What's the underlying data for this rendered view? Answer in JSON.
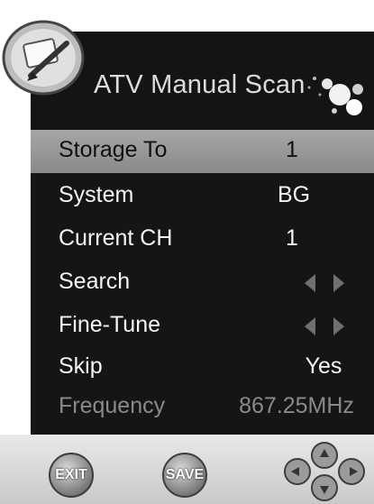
{
  "header": {
    "title": "ATV Manual Scan"
  },
  "rows": [
    {
      "label": "Storage To",
      "value": "1"
    },
    {
      "label": "System",
      "value": "BG"
    },
    {
      "label": "Current CH",
      "value": "1"
    },
    {
      "label": "Search",
      "value": ""
    },
    {
      "label": "Fine-Tune",
      "value": ""
    },
    {
      "label": "Skip",
      "value": "Yes"
    },
    {
      "label": "Frequency",
      "value": "867.25MHz"
    }
  ],
  "footer": {
    "exit_label": "EXIT",
    "save_label": "SAVE"
  },
  "colors": {
    "panel": "#151515",
    "selected_row": "#9a9a9a",
    "footer": "#d8d8d8",
    "dim_text": "#8a8a8a"
  }
}
